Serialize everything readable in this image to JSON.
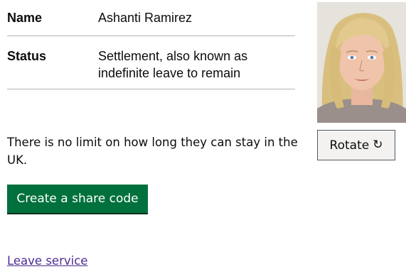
{
  "summary": {
    "rows": [
      {
        "key": "Name",
        "value": "Ashanti Ramirez"
      },
      {
        "key": "Status",
        "value_lines": [
          "Settlement, also known as",
          "indefinite leave to remain"
        ]
      }
    ]
  },
  "info": {
    "text": "There is no limit on how long they can stay in the UK."
  },
  "actions": {
    "share_label": "Create a share code",
    "rotate_label": "Rotate",
    "rotate_icon": "rotate-icon",
    "leave_label": "Leave service"
  },
  "photo": {
    "icon": "portrait-photo"
  },
  "colors": {
    "button_green": "#00703c",
    "link_purple": "#4c2c92",
    "divider": "#b1b4b6"
  }
}
